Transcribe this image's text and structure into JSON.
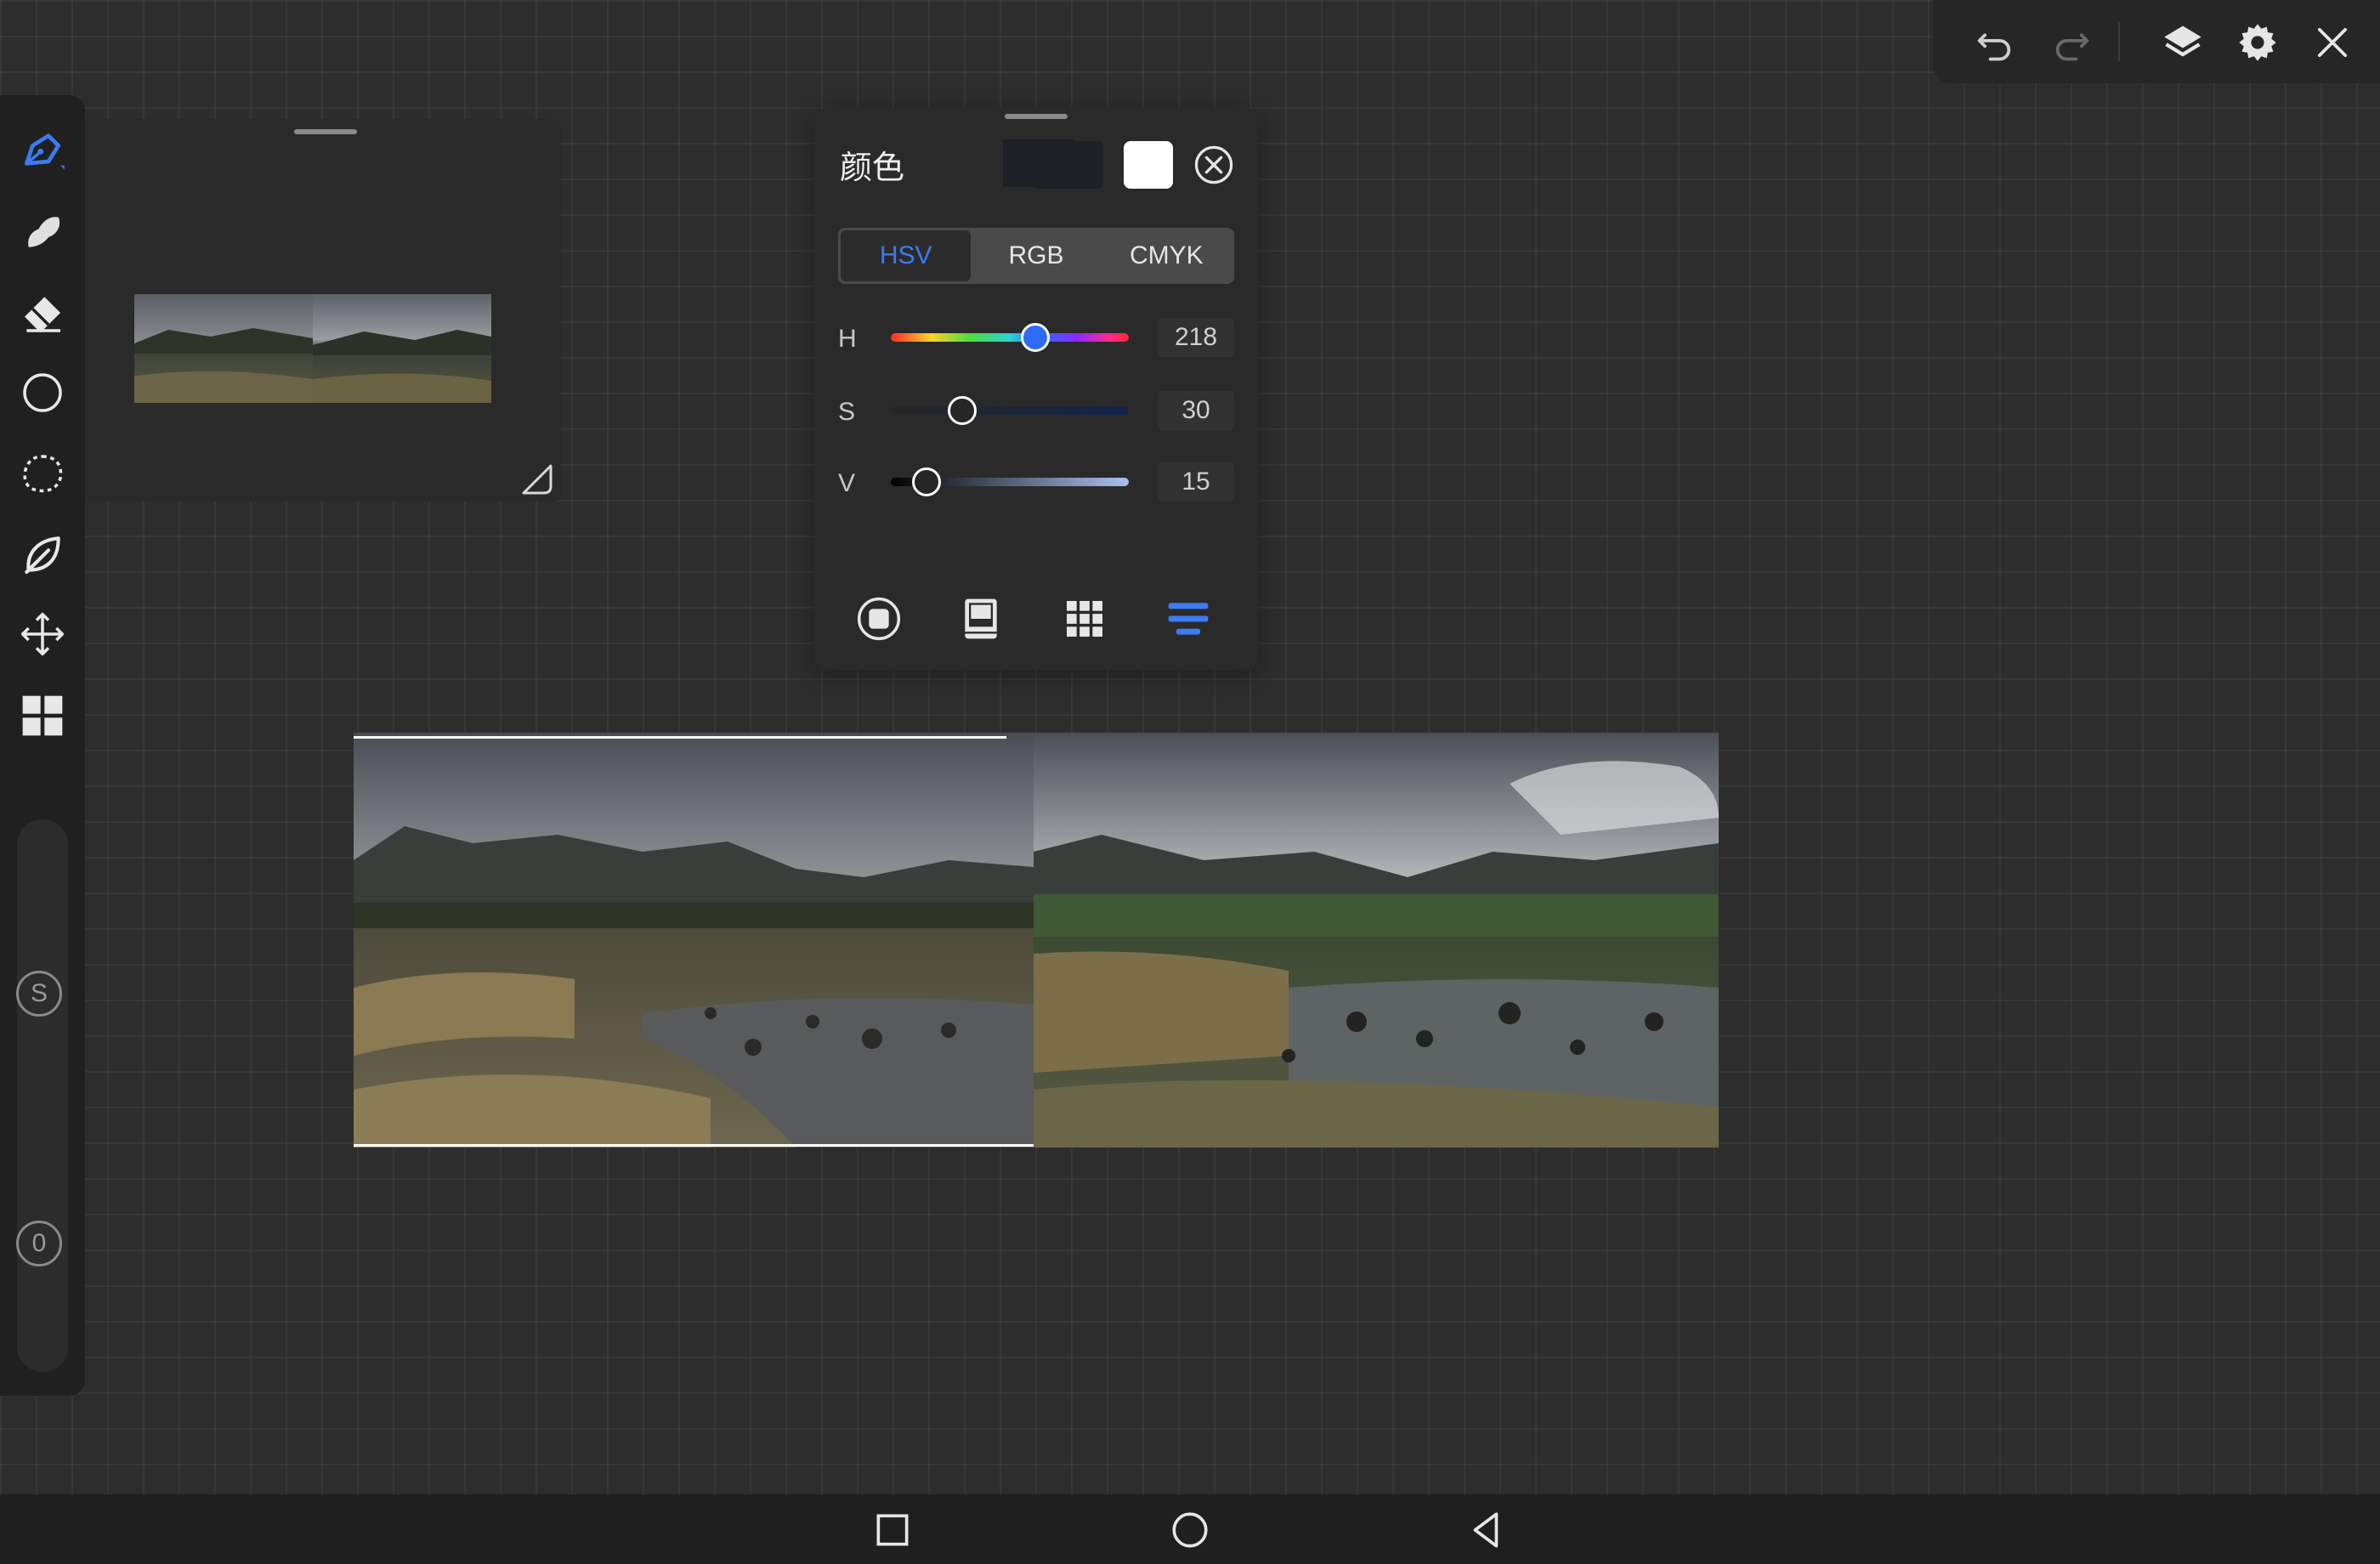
{
  "top_toolbar": {
    "icons": [
      "undo-icon",
      "redo-icon",
      "layers-icon",
      "settings-icon",
      "close-icon"
    ]
  },
  "left_toolbar": {
    "tools": [
      "brush-pen-icon",
      "smudge-icon",
      "eraser-icon",
      "ellipse-icon",
      "lasso-selection-icon",
      "leaf-fill-icon",
      "move-icon",
      "grid-layout-icon"
    ],
    "active_tool": "brush-pen-icon",
    "size_slider_label": "S",
    "opacity_slider_label": "0"
  },
  "reference_panel": {
    "thumbnails": [
      "reference-photo-left",
      "reference-photo-right"
    ]
  },
  "color_panel": {
    "title": "颜色",
    "current_color": "#1e2026",
    "secondary_color": "#ffffff",
    "tabs": [
      "HSV",
      "RGB",
      "CMYK"
    ],
    "active_tab": "HSV",
    "hsv": {
      "h_label": "H",
      "h_value": "218",
      "s_label": "S",
      "s_value": "30",
      "v_label": "V",
      "v_value": "15"
    },
    "bottom_icons": [
      "color-wheel-icon",
      "palette-book-icon",
      "swatches-grid-icon",
      "sliders-icon"
    ],
    "active_bottom_icon": "sliders-icon"
  },
  "colors": {
    "accent": "#3d7bf2",
    "panel_bg": "#2a2a2a",
    "canvas_bg": "#2d2d2d"
  },
  "nav_bar": {
    "icons": [
      "recent-apps-icon",
      "home-icon",
      "back-icon"
    ]
  }
}
